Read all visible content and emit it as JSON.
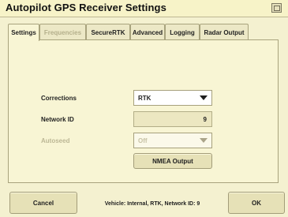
{
  "window": {
    "title": "Autopilot GPS Receiver Settings"
  },
  "tabs": [
    {
      "label": "Settings",
      "state": "active"
    },
    {
      "label": "Frequencies",
      "state": "disabled"
    },
    {
      "label": "SecureRTK",
      "state": "normal"
    },
    {
      "label": "Advanced",
      "state": "normal"
    },
    {
      "label": "Logging",
      "state": "normal"
    },
    {
      "label": "Radar Output",
      "state": "normal"
    }
  ],
  "form": {
    "corrections": {
      "label": "Corrections",
      "value": "RTK"
    },
    "network_id": {
      "label": "Network ID",
      "value": "9"
    },
    "autoseed": {
      "label": "Autoseed",
      "value": "Off",
      "enabled": false
    },
    "nmea_output_label": "NMEA Output"
  },
  "footer": {
    "cancel_label": "Cancel",
    "ok_label": "OK",
    "status_text": "Vehicle: Internal, RTK, Network ID: 9"
  },
  "icons": {
    "window_icon": "window-icon"
  },
  "colors": {
    "background": "#f4f1d0",
    "panel": "#f8f5d4",
    "button": "#e6e1b7",
    "text": "#1f1f1f"
  }
}
